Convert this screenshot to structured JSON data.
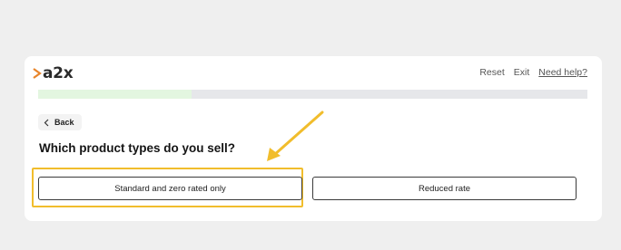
{
  "header": {
    "logo_text": "a2x",
    "links": {
      "reset": "Reset",
      "exit": "Exit",
      "help": "Need help?"
    }
  },
  "progress": {
    "fraction": 0.28
  },
  "nav": {
    "back_label": "Back"
  },
  "question": {
    "title": "Which product types do you sell?"
  },
  "options": [
    {
      "label": "Standard and zero rated only",
      "highlighted": true
    },
    {
      "label": "Reduced rate",
      "highlighted": false
    }
  ],
  "colors": {
    "brand_chevron": "#e8852b",
    "highlight": "#f1bd2c",
    "progress_fill": "#e3f6e0",
    "progress_track": "#e6e7ea"
  }
}
